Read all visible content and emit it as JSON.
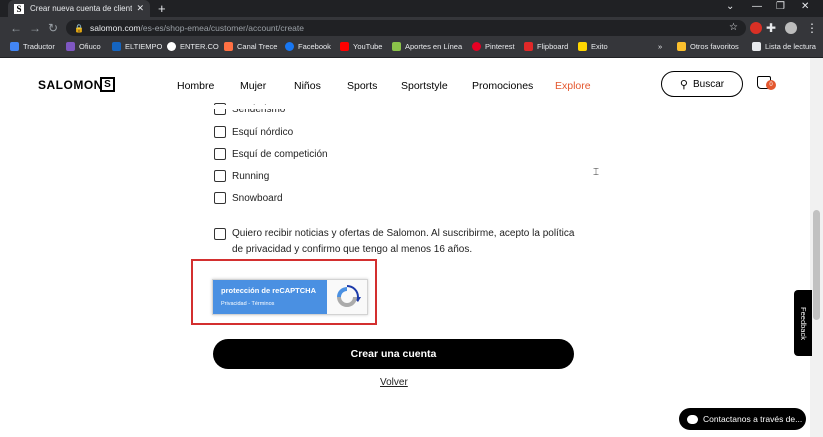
{
  "browser": {
    "tab_title": "Crear nueva cuenta de cliente",
    "tab_favicon": "S",
    "url_domain": "salomon.com",
    "url_path": "/es-es/shop-emea/customer/account/create"
  },
  "bookmarks": [
    {
      "label": "Traductor",
      "color": "#4285f4"
    },
    {
      "label": "Ofiuco",
      "color": "#7e57c2"
    },
    {
      "label": "ELTIEMPO",
      "color": "#1565c0"
    },
    {
      "label": "ENTER.CO",
      "color": "#ffffff"
    },
    {
      "label": "Canal Trece",
      "color": "#ff7043"
    },
    {
      "label": "Facebook",
      "color": "#1877f2"
    },
    {
      "label": "YouTube",
      "color": "#ff0000"
    },
    {
      "label": "Aportes en Línea",
      "color": "#8bc34a"
    },
    {
      "label": "Pinterest",
      "color": "#e60023"
    },
    {
      "label": "Flipboard",
      "color": "#e12828"
    },
    {
      "label": "Exito",
      "color": "#ffd600"
    }
  ],
  "bookmarks_more": "»",
  "bookmarks_other": "Otros favoritos",
  "bookmarks_reading": "Lista de lectura",
  "site": {
    "logo": "SALOMON",
    "logo_mark": "S",
    "nav": [
      "Hombre",
      "Mujer",
      "Niños",
      "Sports",
      "Sportstyle",
      "Promociones",
      "Explore"
    ],
    "search_label": "Buscar",
    "cart_count": "0"
  },
  "form": {
    "options": [
      "Senderismo",
      "Esquí nórdico",
      "Esquí de competición",
      "Running",
      "Snowboard"
    ],
    "consent_text": "Quiero recibir noticias y ofertas de Salomon. Al suscribirme, acepto la política de privacidad y confirmo que tengo al menos 16 años.",
    "recaptcha_title": "protección de reCAPTCHA",
    "recaptcha_links": "Privacidad - Términos",
    "create_button": "Crear una cuenta",
    "back_link": "Volver"
  },
  "widgets": {
    "feedback": "Feedback",
    "chat": "Contactanos a través de..."
  },
  "colors": {
    "accent": "#e4572e",
    "highlight": "#d32f2f",
    "recaptcha_blue": "#4a90e2"
  }
}
